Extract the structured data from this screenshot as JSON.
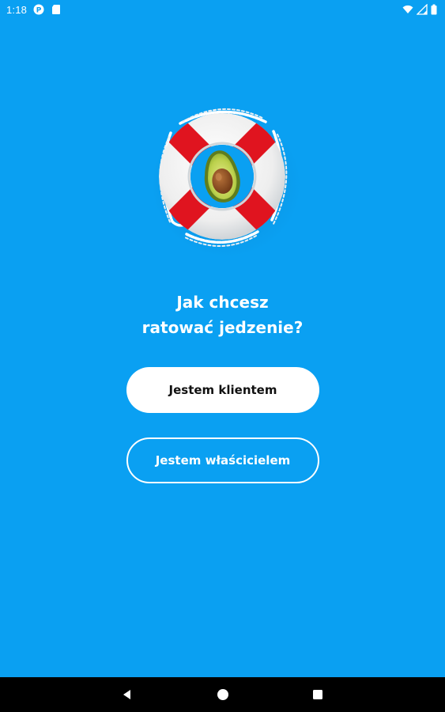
{
  "status_bar": {
    "time": "1:18",
    "icons": [
      "p-notification-icon",
      "sd-card-icon",
      "wifi-icon",
      "signal-icon",
      "battery-icon"
    ]
  },
  "hero": {
    "image": "lifebuoy-with-avocado",
    "colors": {
      "ring": "#f4f4f4",
      "stripe": "#e0141f",
      "rope": "#ffffff",
      "avocado_skin": "#6d8a22",
      "avocado_flesh": "#c8d957",
      "avocado_pit": "#8a4a1f"
    }
  },
  "content": {
    "headline_line1": "Jak chcesz",
    "headline_line2": "ratować jedzenie?",
    "client_button": "Jestem klientem",
    "owner_button": "Jestem właścicielem"
  },
  "nav_bar": {
    "icons": [
      "back-icon",
      "home-icon",
      "recents-icon"
    ]
  },
  "colors": {
    "background": "#0aa0f2",
    "primary_button_bg": "#ffffff",
    "primary_button_text": "#111111",
    "outline_button_border": "#ffffff",
    "nav_bar": "#000000"
  }
}
